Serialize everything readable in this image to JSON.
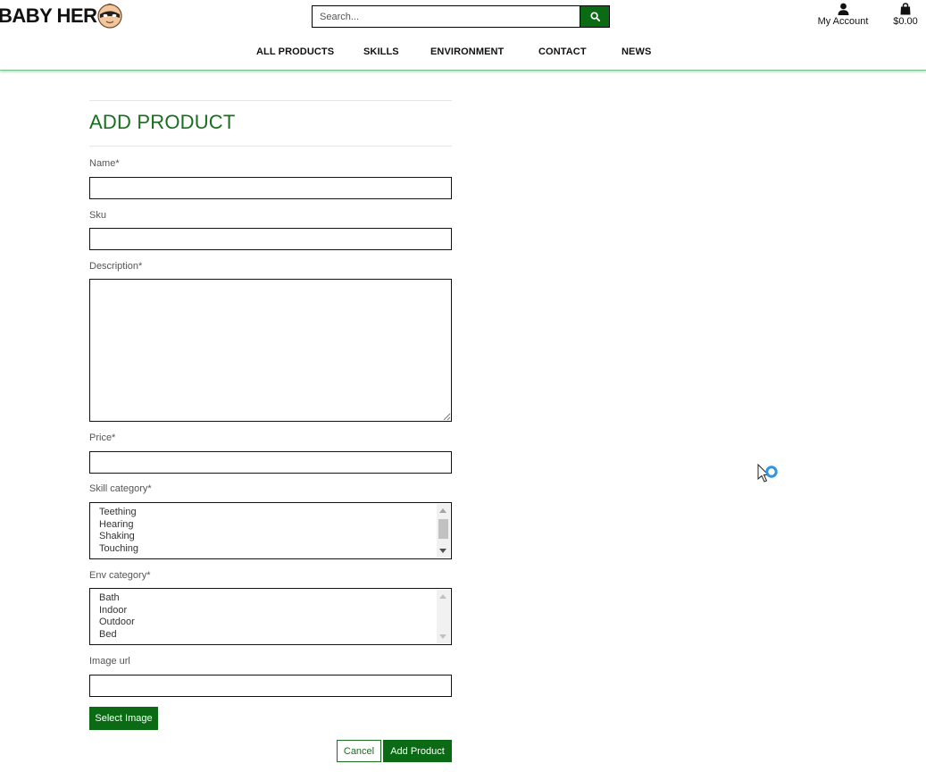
{
  "header": {
    "brand": "BABY HER",
    "search_placeholder": "Search...",
    "account_label": "My Account",
    "bag_total": "$0.00"
  },
  "nav": {
    "items": [
      "ALL PRODUCTS",
      "SKILLS",
      "ENVIRONMENT",
      "CONTACT",
      "NEWS"
    ]
  },
  "form": {
    "title": "ADD PRODUCT",
    "name_label": "Name*",
    "name_value": "",
    "sku_label": "Sku",
    "sku_value": "",
    "description_label": "Description*",
    "description_value": "",
    "price_label": "Price*",
    "price_value": "",
    "skill_label": "Skill category*",
    "skill_options": [
      "Teething",
      "Hearing",
      "Shaking",
      "Touching"
    ],
    "env_label": "Env category*",
    "env_options": [
      "Bath",
      "Indoor",
      "Outdoor",
      "Bed"
    ],
    "image_url_label": "Image url",
    "image_url_value": "",
    "select_image_label": "Select Image",
    "cancel_label": "Cancel",
    "submit_label": "Add Product"
  },
  "colors": {
    "brand_green": "#0b6b14",
    "title_green": "#1a6e1f",
    "header_rule": "#78c08e",
    "cursor_badge": "#2f95e2"
  },
  "icons": {
    "search": "magnifier-icon",
    "account": "user-icon",
    "bag": "shopping-bag-icon",
    "logo": "baby-hero-mask-icon",
    "cursor": "busy-cursor-icon"
  }
}
